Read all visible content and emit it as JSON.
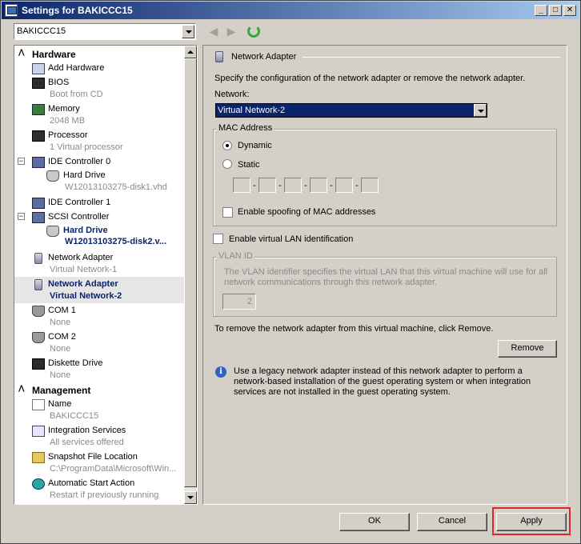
{
  "window": {
    "title": "Settings for BAKICCC15",
    "minimize": "_",
    "maximize": "□",
    "close": "✕"
  },
  "vm_selector": {
    "value": "BAKICCC15"
  },
  "nav": {
    "back": "◀",
    "forward": "▶"
  },
  "tree": {
    "hardware_header": "Hardware",
    "management_header": "Management",
    "expand_minus": "−",
    "items": [
      {
        "label": "Add Hardware",
        "sub": ""
      },
      {
        "label": "BIOS",
        "sub": "Boot from CD"
      },
      {
        "label": "Memory",
        "sub": "2048 MB"
      },
      {
        "label": "Processor",
        "sub": "1 Virtual processor"
      },
      {
        "label": "IDE Controller 0",
        "sub": ""
      },
      {
        "label": "Hard Drive",
        "sub": "W12013103275-disk1.vhd"
      },
      {
        "label": "IDE Controller 1",
        "sub": ""
      },
      {
        "label": "SCSI Controller",
        "sub": ""
      },
      {
        "label": "Hard Drive",
        "sub": "W12013103275-disk2.v..."
      },
      {
        "label": "Network Adapter",
        "sub": "Virtual Network-1"
      },
      {
        "label": "Network Adapter",
        "sub": "Virtual Network-2"
      },
      {
        "label": "COM 1",
        "sub": "None"
      },
      {
        "label": "COM 2",
        "sub": "None"
      },
      {
        "label": "Diskette Drive",
        "sub": "None"
      }
    ],
    "management_items": [
      {
        "label": "Name",
        "sub": "BAKICCC15"
      },
      {
        "label": "Integration Services",
        "sub": "All services offered"
      },
      {
        "label": "Snapshot File Location",
        "sub": "C:\\ProgramData\\Microsoft\\Win..."
      },
      {
        "label": "Automatic Start Action",
        "sub": "Restart if previously running"
      }
    ]
  },
  "pane": {
    "section_title": "Network Adapter",
    "description": "Specify the configuration of the network adapter or remove the network adapter.",
    "network_label": "Network:",
    "network_value": "Virtual Network-2",
    "mac_group": "MAC Address",
    "dynamic": "Dynamic",
    "static": "Static",
    "mac_dash": "-",
    "spoofing": "Enable spoofing of MAC addresses",
    "vlan_check": "Enable virtual LAN identification",
    "vlan_group": "VLAN ID",
    "vlan_desc_1": "The VLAN identifier specifies the virtual LAN that this virtual machine will use for all",
    "vlan_desc_2": "network communications through this network adapter.",
    "vlan_value": "2",
    "remove_text": "To remove the network adapter from this virtual machine, click Remove.",
    "remove_button": "Remove",
    "info_1": "Use a legacy network adapter instead of this network adapter to perform a",
    "info_2": "network-based installation of the guest operating system or when integration",
    "info_3": "services are not installed in the guest operating system."
  },
  "footer": {
    "ok": "OK",
    "cancel": "Cancel",
    "apply": "Apply"
  }
}
